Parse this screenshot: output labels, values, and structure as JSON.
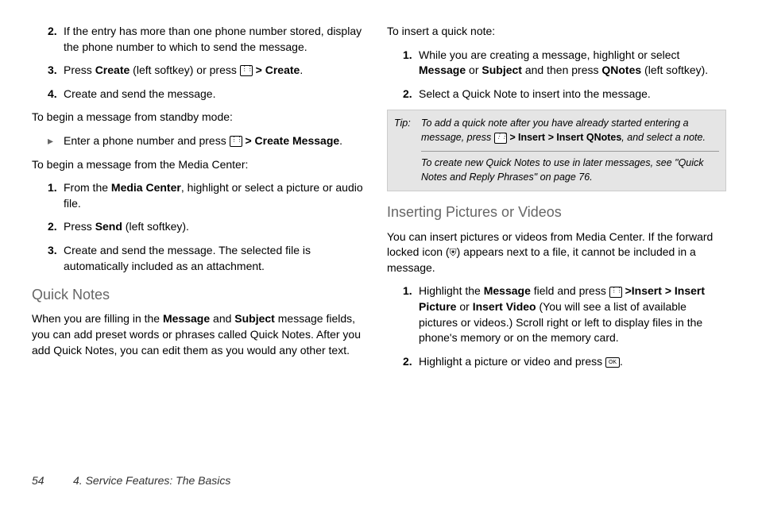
{
  "left": {
    "step2": "If the entry has more than one phone number stored, display the phone number to which to send the message.",
    "step3_a": "Press ",
    "step3_b": "Create",
    "step3_c": " (left softkey) or press ",
    "step3_gt": ">",
    "step3_d": "Create",
    "step3_e": ".",
    "step4": "Create and send the message.",
    "lead_standby": "To begin a message from standby mode:",
    "bullet_a": "Enter a phone number and press ",
    "bullet_gt": ">",
    "bullet_b": "Create Message",
    "bullet_c": ".",
    "lead_media": "To begin a message from the Media Center:",
    "m1_a": "From the ",
    "m1_b": "Media Center",
    "m1_c": ", highlight or select a picture or audio file.",
    "m2_a": "Press ",
    "m2_b": "Send",
    "m2_c": " (left softkey).",
    "m3": "Create and send the message. The selected file is automatically included as an attachment.",
    "h_quicknotes": "Quick Notes",
    "qn_a": "When you are filling in the ",
    "qn_b": "Message",
    "qn_c": " and ",
    "qn_d": "Subject",
    "qn_e": " message fields, you can add preset words or phrases called Quick Notes. After you add Quick Notes, you can edit them as you would any other text."
  },
  "right": {
    "lead_insert": "To insert a quick note:",
    "i1_a": "While you are creating a message, highlight or select ",
    "i1_b": "Message",
    "i1_c": " or ",
    "i1_d": "Subject",
    "i1_e": " and then press ",
    "i1_f": "QNotes",
    "i1_g": " (left softkey).",
    "i2": "Select a Quick Note to insert into the message.",
    "tip_label": "Tip:",
    "tip_a": "To add a quick note after you have already started entering a message, press ",
    "tip_gt1": ">",
    "tip_b": "Insert",
    "tip_gt2": ">",
    "tip_c": "Insert QNotes",
    "tip_d": ", and select a note.",
    "tip2": "To create new Quick Notes to use in later messages, see \"Quick Notes and Reply Phrases\" on page 76.",
    "h_pics": "Inserting Pictures or Videos",
    "pics_intro_a": "You can insert pictures or videos from Media Center. If the forward locked icon (",
    "pics_intro_b": ") appears next to a file, it cannot be included in a message.",
    "p1_a": "Highlight the ",
    "p1_b": "Message",
    "p1_c": " field and press ",
    "p1_gt": ">",
    "p1_d": "Insert",
    "p1_gt2": ">",
    "p1_e": "Insert Picture",
    "p1_f": " or ",
    "p1_g": "Insert Video",
    "p1_h": " (You will see a list of available pictures or videos.) Scroll right or left to display files in the phone's memory or on the memory card.",
    "p2_a": "Highlight a picture or video and press ",
    "p2_b": "."
  },
  "footer": {
    "page": "54",
    "title": "4. Service Features: The Basics"
  },
  "nums": {
    "n1": "1.",
    "n2": "2.",
    "n3": "3.",
    "n4": "4."
  },
  "icons": {
    "ok": "OK",
    "bullet": "▸",
    "lock": "⛨"
  }
}
